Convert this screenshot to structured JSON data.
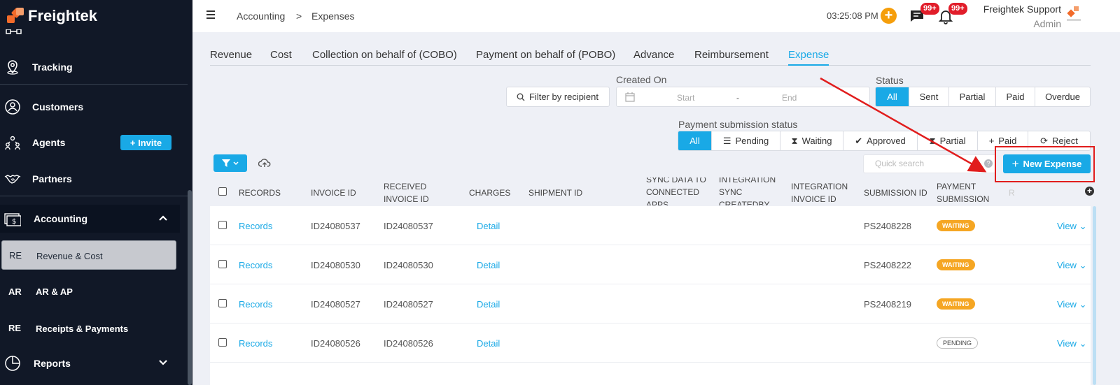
{
  "app": {
    "name": "Freightek"
  },
  "sidebar": {
    "items": [
      {
        "label": "Tracking",
        "icon": "location-pin-icon"
      },
      {
        "label": "Customers",
        "icon": "customers-icon"
      },
      {
        "label": "Agents",
        "icon": "agents-icon",
        "action": "+ Invite"
      },
      {
        "label": "Partners",
        "icon": "handshake-icon"
      },
      {
        "label": "Accounting",
        "icon": "dollar-bill-icon"
      },
      {
        "label": "Reports",
        "icon": "pie-chart-icon"
      }
    ],
    "sub_items": [
      {
        "abbr": "RE",
        "label": "Revenue & Cost",
        "active": true
      },
      {
        "abbr": "AR",
        "label": "AR & AP"
      },
      {
        "abbr": "RE",
        "label": "Receipts & Payments"
      }
    ]
  },
  "header": {
    "breadcrumb": [
      "Accounting",
      ">",
      "Expenses"
    ],
    "time": "03:25:08 PM",
    "chat_badge": "99+",
    "bell_badge": "99+",
    "user_name": "Freightek Support",
    "user_role": "Admin"
  },
  "tabs": [
    "Revenue",
    "Cost",
    "Collection on behalf of (COBO)",
    "Payment on behalf of (POBO)",
    "Advance",
    "Reimbursement",
    "Expense"
  ],
  "filters": {
    "recipient_placeholder": "Filter by recipient",
    "created_on_label": "Created On",
    "start_placeholder": "Start",
    "range_sep": "-",
    "end_placeholder": "End",
    "status_label": "Status",
    "status_options": [
      "All",
      "Sent",
      "Partial",
      "Paid",
      "Overdue"
    ],
    "payment_label": "Payment submission status",
    "payment_options": [
      "All",
      "Pending",
      "Waiting",
      "Approved",
      "Partial",
      "Paid",
      "Reject"
    ]
  },
  "toolbar": {
    "quick_search_placeholder": "Quick search",
    "new_expense_label": "New Expense"
  },
  "table": {
    "columns": [
      "RECORDS",
      "INVOICE ID",
      "RECEIVED INVOICE ID",
      "CHARGES",
      "SHIPMENT ID",
      "SYNC DATA TO CONNECTED APPS",
      "INTEGRATION SYNC CREATEDBY",
      "INTEGRATION INVOICE ID",
      "SUBMISSION ID",
      "PAYMENT SUBMISSION",
      "R"
    ],
    "rows": [
      {
        "records": "Records",
        "invoice_id": "ID24080537",
        "received_invoice_id": "ID24080537",
        "charges": "Detail",
        "submission_id": "PS2408228",
        "payment_submission": "WAITING",
        "action": "View"
      },
      {
        "records": "Records",
        "invoice_id": "ID24080530",
        "received_invoice_id": "ID24080530",
        "charges": "Detail",
        "submission_id": "PS2408222",
        "payment_submission": "WAITING",
        "action": "View"
      },
      {
        "records": "Records",
        "invoice_id": "ID24080527",
        "received_invoice_id": "ID24080527",
        "charges": "Detail",
        "submission_id": "PS2408219",
        "payment_submission": "WAITING",
        "action": "View"
      },
      {
        "records": "Records",
        "invoice_id": "ID24080526",
        "received_invoice_id": "ID24080526",
        "charges": "Detail",
        "submission_id": "",
        "payment_submission": "PENDING",
        "action": "View"
      }
    ]
  },
  "colors": {
    "accent": "#19a9e6",
    "sidebar": "#111827",
    "waiting": "#f5a623",
    "annotation": "#e11d1d",
    "brand": "#f26b2a"
  }
}
